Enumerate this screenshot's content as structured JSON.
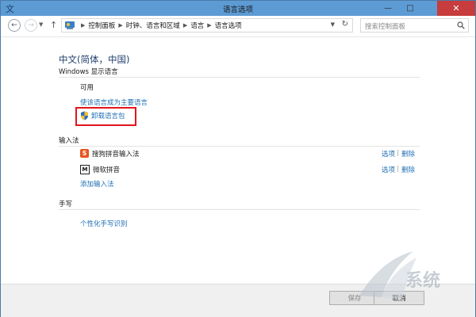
{
  "window": {
    "title": "语言选项"
  },
  "address_bar": {
    "breadcrumbs": [
      "控制面板",
      "时钟、语言和区域",
      "语言",
      "语言选项"
    ],
    "search_placeholder": "搜索控制面板"
  },
  "language": {
    "heading": "中文(简体，中国)",
    "display_section": "Windows 显示语言",
    "availability": "可用",
    "make_primary_link": "使该语言成为主要语言",
    "uninstall_link": "卸载语言包"
  },
  "input_methods": {
    "section": "输入法",
    "items": [
      {
        "name": "搜狗拼音输入法",
        "icon": "sogou-icon",
        "options": "选项",
        "remove": "删除"
      },
      {
        "name": "微软拼音",
        "icon": "microsoft-pinyin-icon",
        "options": "选项",
        "remove": "删除"
      }
    ],
    "add_link": "添加输入法"
  },
  "handwriting": {
    "section": "手写",
    "personalize_link": "个性化手写识别"
  },
  "footer": {
    "save_label": "保存",
    "cancel_label": "取消"
  },
  "colors": {
    "title_bar": "#5d9bd4",
    "link": "#1f6fb4",
    "highlight": "#e4141b",
    "close_button": "#c73c3c"
  }
}
